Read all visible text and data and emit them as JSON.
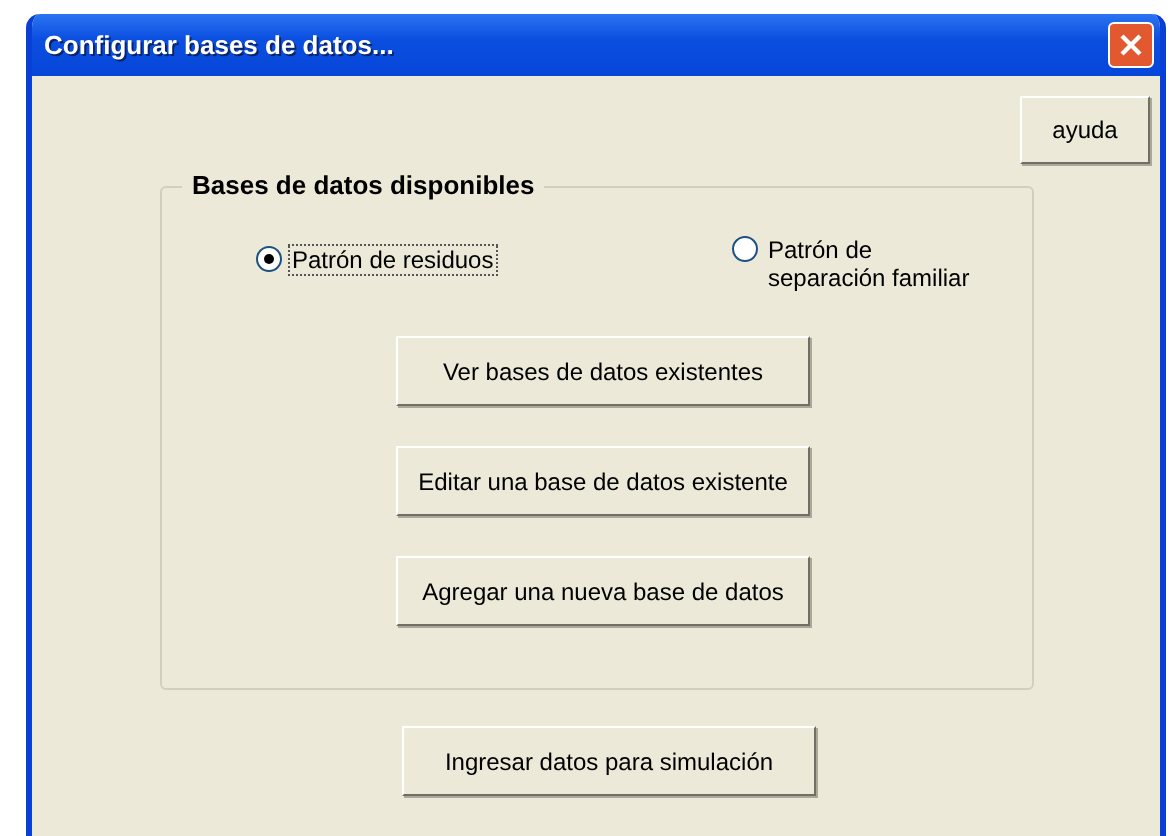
{
  "window": {
    "title": "Configurar bases de datos..."
  },
  "help_button": "ayuda",
  "group": {
    "title": "Bases de datos disponibles",
    "radios": [
      {
        "label": "Patrón de residuos",
        "selected": true,
        "focused": true
      },
      {
        "label": "Patrón de separación familiar",
        "selected": false,
        "focused": false
      }
    ],
    "buttons": [
      "Ver bases de datos existentes",
      "Editar una base de datos existente",
      "Agregar una nueva base de datos"
    ]
  },
  "bottom_button": "Ingresar datos para simulación"
}
